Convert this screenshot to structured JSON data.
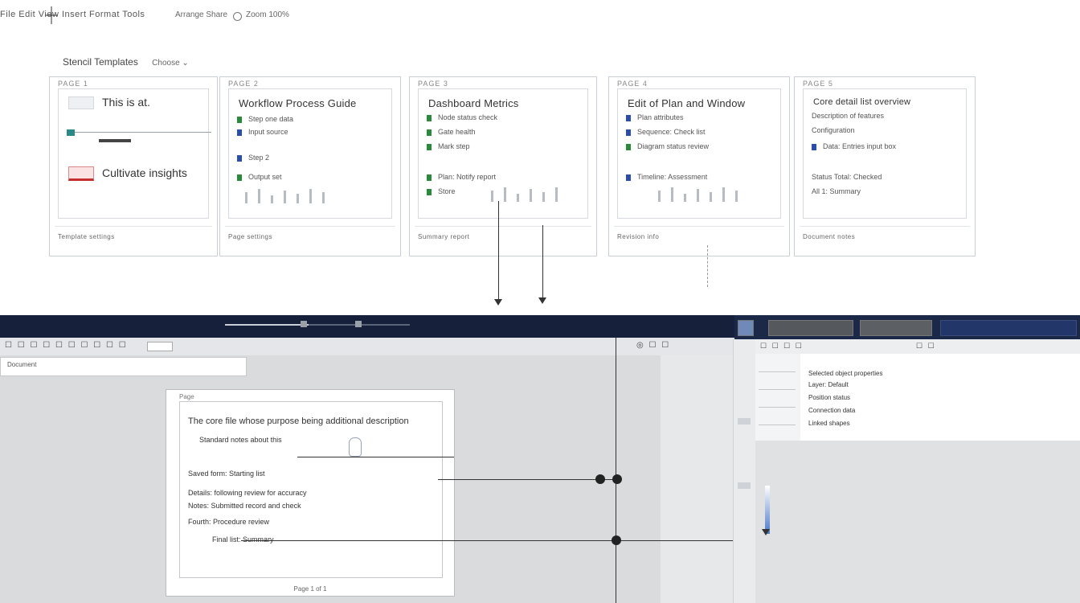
{
  "toolbar": {
    "left_text": "File  Edit  View  Insert  Format  Tools",
    "mid_text": "Arrange  Share",
    "right_text": "Zoom  100%"
  },
  "section": {
    "title": "Stencil Templates",
    "dropdown": "Choose"
  },
  "panels": [
    {
      "header": "PAGE 1",
      "rows": [
        "This is at.",
        "Cultivate insights"
      ],
      "footer": "Template settings"
    },
    {
      "header": "PAGE 2",
      "title": "Workflow Process Guide",
      "rows": [
        "Step one data",
        "Input source",
        "Step 2",
        "Output set"
      ],
      "footer": "Page settings"
    },
    {
      "header": "PAGE 3",
      "title": "Dashboard Metrics",
      "rows": [
        "Node status check",
        "Gate health",
        "Mark step",
        "Plan: Notify report",
        "Store"
      ],
      "footer": "Summary report"
    },
    {
      "header": "PAGE 4",
      "title": "Edit of Plan and Window",
      "rows": [
        "Plan attributes",
        "Sequence: Check list",
        "Diagram status review",
        "Timeline: Assessment"
      ],
      "footer": "Revision info"
    },
    {
      "header": "PAGE 5",
      "title": "Core detail list overview",
      "rows": [
        "Description of features",
        "Configuration",
        "Data: Entries input box",
        "Status Total: Checked",
        "All 1: Summary"
      ],
      "footer": "Document notes"
    }
  ],
  "app": {
    "address": "Document",
    "progress": 0.45,
    "tools_left": "☐ ☐ ☐ ☐ ☐ ☐ ☐ ☐ ☐ ☐",
    "tools_right": "◎ ☐ ☐"
  },
  "document": {
    "header": "Page",
    "lines": [
      "The core file whose purpose being additional description",
      "Standard notes about this",
      "Saved form: Starting list",
      "Details: following review for accuracy",
      "Notes: Submitted record and check",
      "Fourth: Procedure review",
      "Final list: Summary"
    ],
    "footer": "Page 1 of 1"
  },
  "inspector": {
    "tools": "☐ ☐ ☐ ☐",
    "tools2": "☐ ☐",
    "lines": [
      "Selected object properties",
      "Layer: Default",
      "Position status",
      "Connection data",
      "Linked shapes"
    ]
  }
}
